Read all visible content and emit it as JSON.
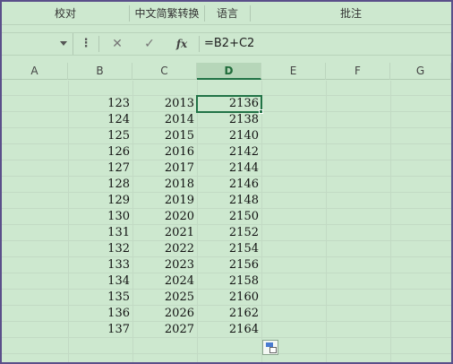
{
  "ribbon": {
    "groups": [
      "校对",
      "中文简繁转换",
      "语言",
      "批注"
    ]
  },
  "formula_bar": {
    "name_box": "",
    "more_icon": "⋮",
    "cancel_icon": "✕",
    "confirm_icon": "✓",
    "fx_label": "fx",
    "formula": "=B2+C2"
  },
  "columns": [
    "A",
    "B",
    "C",
    "D",
    "E",
    "F",
    "G"
  ],
  "selected_column": "D",
  "rows": [
    {
      "b": "123",
      "c": "2013",
      "d": "2136"
    },
    {
      "b": "124",
      "c": "2014",
      "d": "2138"
    },
    {
      "b": "125",
      "c": "2015",
      "d": "2140"
    },
    {
      "b": "126",
      "c": "2016",
      "d": "2142"
    },
    {
      "b": "127",
      "c": "2017",
      "d": "2144"
    },
    {
      "b": "128",
      "c": "2018",
      "d": "2146"
    },
    {
      "b": "129",
      "c": "2019",
      "d": "2148"
    },
    {
      "b": "130",
      "c": "2020",
      "d": "2150"
    },
    {
      "b": "131",
      "c": "2021",
      "d": "2152"
    },
    {
      "b": "132",
      "c": "2022",
      "d": "2154"
    },
    {
      "b": "133",
      "c": "2023",
      "d": "2156"
    },
    {
      "b": "134",
      "c": "2024",
      "d": "2158"
    },
    {
      "b": "135",
      "c": "2025",
      "d": "2160"
    },
    {
      "b": "136",
      "c": "2026",
      "d": "2162"
    },
    {
      "b": "137",
      "c": "2027",
      "d": "2164"
    }
  ],
  "colors": {
    "sheet_background": "#cde8cf",
    "selection": "#217346",
    "window_frame": "#5a4f8a"
  }
}
